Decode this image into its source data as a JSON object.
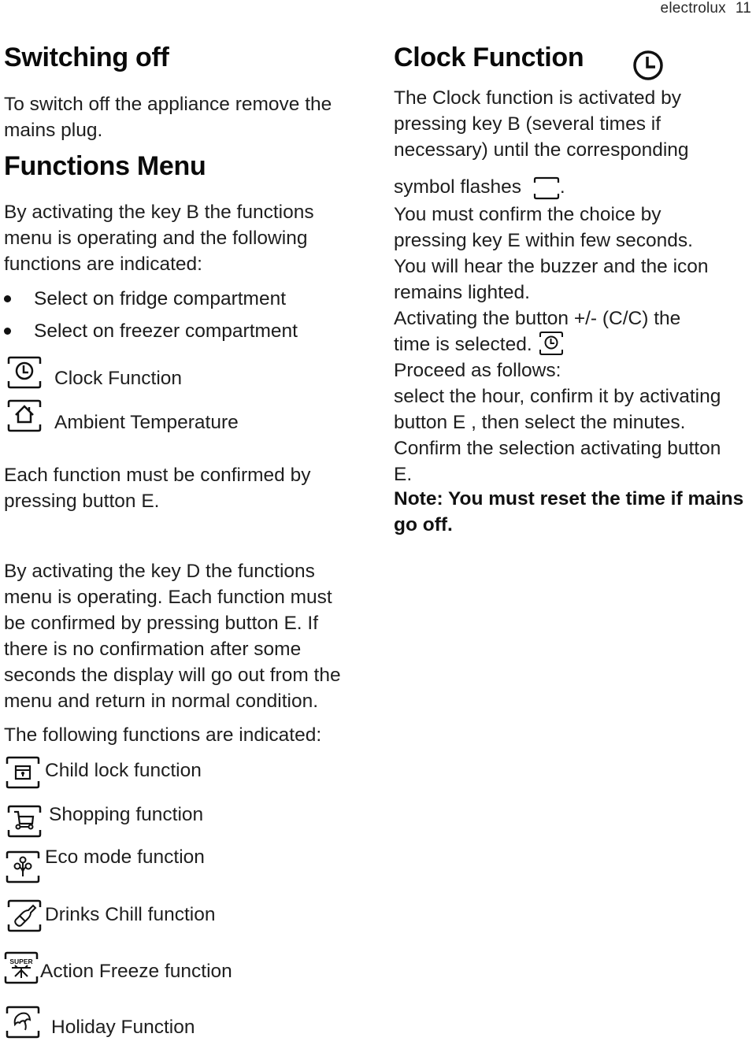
{
  "header": {
    "brand": "electrolux",
    "page_number": "11"
  },
  "left": {
    "switching_off": {
      "title": "Switching off",
      "lines": [
        "To switch off the appliance remove the",
        "mains plug."
      ]
    },
    "functions_menu": {
      "title": "Functions Menu",
      "intro_lines": [
        "By activating the key B the functions",
        "menu is operating and  the following",
        "functions are indicated:"
      ],
      "bullets": [
        "Select on fridge compartment",
        "Select on freezer compartment"
      ],
      "icon_items": [
        {
          "icon": "clock-icon",
          "label": "Clock Function"
        },
        {
          "icon": "house-icon",
          "label": "Ambient Temperature"
        }
      ],
      "confirm_lines": [
        "Each function must be confirmed by",
        "pressing button E."
      ],
      "key_d_lines": [
        "By activating the key D the functions",
        "menu is operating. Each function must",
        "be confirmed by pressing button E. If",
        "there is no confirmation after some",
        "seconds the display will go out from the",
        "menu and return in normal condition."
      ],
      "following_label": "The following functions are indicated:",
      "functions": [
        {
          "icon": "lock-icon",
          "label": "Child lock function"
        },
        {
          "icon": "shopping-cart-icon",
          "label": "Shopping function"
        },
        {
          "icon": "eco-mode-icon",
          "label": "Eco mode function"
        },
        {
          "icon": "bottle-icon",
          "label": "Drinks Chill function"
        },
        {
          "icon": "super-freeze-icon",
          "label": "Action Freeze function",
          "icon_text": "SUPER"
        },
        {
          "icon": "umbrella-icon",
          "label": "Holiday Function"
        }
      ]
    }
  },
  "right": {
    "clock_function": {
      "title": "Clock Function",
      "lines": [
        "The Clock function is activated by",
        "pressing key B (several times if",
        "necessary) until the corresponding"
      ],
      "symbol_line_before": "symbol flashes",
      "symbol_line_after": ".",
      "lines2": [
        "You must confirm the choice by",
        "pressing key E within few seconds.",
        "You will hear the buzzer and the icon",
        "remains lighted.",
        "Activating the button +/- (C/C)  the"
      ],
      "time_selected": "time is selected.",
      "lines3": [
        "Proceed as follows:",
        "select the hour, confirm it by activating",
        "button E , then select the minutes.",
        "Confirm the selection activating button",
        "E."
      ],
      "note_lines": [
        "Note: You must reset the time if mains",
        "go off."
      ]
    }
  }
}
